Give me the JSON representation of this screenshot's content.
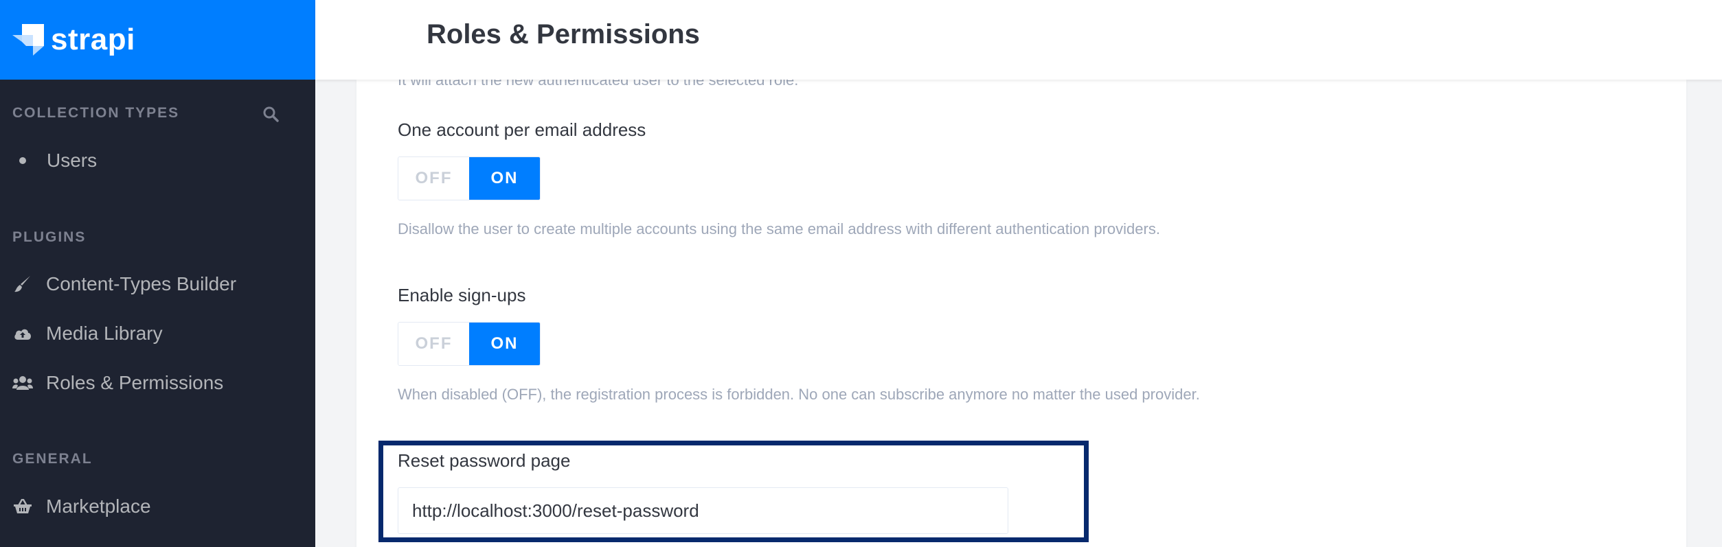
{
  "brand": {
    "name": "strapi"
  },
  "sidebar": {
    "collection_types_title": "COLLECTION TYPES",
    "collection_items": [
      {
        "label": "Users"
      }
    ],
    "plugins_title": "PLUGINS",
    "plugin_items": [
      {
        "label": "Content-Types Builder",
        "icon": "paintbrush-icon"
      },
      {
        "label": "Media Library",
        "icon": "cloud-upload-icon"
      },
      {
        "label": "Roles & Permissions",
        "icon": "users-icon"
      }
    ],
    "general_title": "GENERAL",
    "general_items": [
      {
        "label": "Marketplace",
        "icon": "basket-icon"
      }
    ]
  },
  "header": {
    "title": "Roles & Permissions"
  },
  "settings": {
    "partial_text": "It will attach the new authenticated user to the selected role.",
    "one_account": {
      "label": "One account per email address",
      "off": "OFF",
      "on": "ON",
      "description": "Disallow the user to create multiple accounts using the same email address with different authentication providers."
    },
    "signups": {
      "label": "Enable sign-ups",
      "off": "OFF",
      "on": "ON",
      "description": "When disabled (OFF), the registration process is forbidden. No one can subscribe anymore no matter the used provider."
    },
    "reset_password": {
      "label": "Reset password page",
      "value": "http://localhost:3000/reset-password"
    }
  },
  "colors": {
    "brand": "#007eff",
    "sidebar": "#1e2331",
    "highlight": "#06296d"
  }
}
